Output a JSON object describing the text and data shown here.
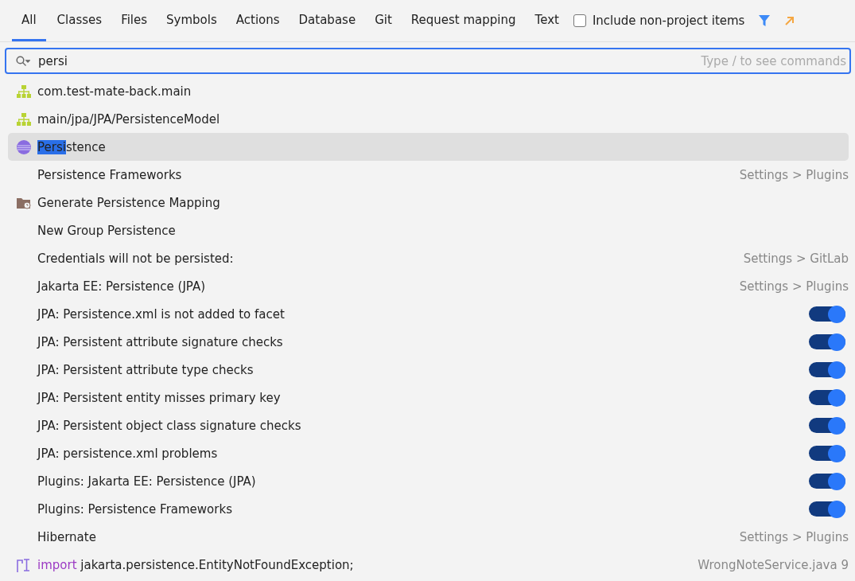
{
  "tabs": [
    {
      "label": "All",
      "selected": true
    },
    {
      "label": "Classes",
      "selected": false
    },
    {
      "label": "Files",
      "selected": false
    },
    {
      "label": "Symbols",
      "selected": false
    },
    {
      "label": "Actions",
      "selected": false
    },
    {
      "label": "Database",
      "selected": false
    },
    {
      "label": "Git",
      "selected": false
    },
    {
      "label": "Request mapping",
      "selected": false
    },
    {
      "label": "Text",
      "selected": false
    }
  ],
  "include_non_project": {
    "label": "Include non-project items",
    "checked": false
  },
  "search": {
    "value": "persi",
    "placeholder": "Type / to see commands"
  },
  "results": [
    {
      "kind": "module",
      "label": "com.test-mate-back.main",
      "selected": false
    },
    {
      "kind": "module",
      "label": "main/jpa/JPA/PersistenceModel",
      "selected": false
    },
    {
      "kind": "class",
      "match": "Persi",
      "label": "stence",
      "selected": true
    },
    {
      "kind": "plain",
      "label": "Persistence Frameworks",
      "location": "Settings > Plugins",
      "selected": false
    },
    {
      "kind": "action",
      "label": "Generate Persistence Mapping",
      "selected": false
    },
    {
      "kind": "plain",
      "label": "New Group Persistence",
      "selected": false
    },
    {
      "kind": "plain",
      "label": "Credentials will not be persisted:",
      "location": "Settings > GitLab",
      "selected": false
    },
    {
      "kind": "plain",
      "label": "Jakarta EE: Persistence (JPA)",
      "location": "Settings > Plugins",
      "selected": false
    },
    {
      "kind": "toggle",
      "label": "JPA: Persistence.xml is not added to facet",
      "on": true,
      "selected": false
    },
    {
      "kind": "toggle",
      "label": "JPA: Persistent attribute signature checks",
      "on": true,
      "selected": false
    },
    {
      "kind": "toggle",
      "label": "JPA: Persistent attribute type checks",
      "on": true,
      "selected": false
    },
    {
      "kind": "toggle",
      "label": "JPA: Persistent entity misses primary key",
      "on": true,
      "selected": false
    },
    {
      "kind": "toggle",
      "label": "JPA: Persistent object class signature checks",
      "on": true,
      "selected": false
    },
    {
      "kind": "toggle",
      "label": "JPA: persistence.xml problems",
      "on": true,
      "selected": false
    },
    {
      "kind": "toggle",
      "label": "Plugins: Jakarta EE: Persistence (JPA)",
      "on": true,
      "selected": false
    },
    {
      "kind": "toggle",
      "label": "Plugins: Persistence Frameworks",
      "on": true,
      "selected": false
    },
    {
      "kind": "plain",
      "label": "Hibernate",
      "location": "Settings > Plugins",
      "selected": false
    },
    {
      "kind": "code",
      "keyword": "import",
      "label": "jakarta.persistence.EntityNotFoundException;",
      "location": "WrongNoteService.java 9",
      "selected": false
    }
  ]
}
